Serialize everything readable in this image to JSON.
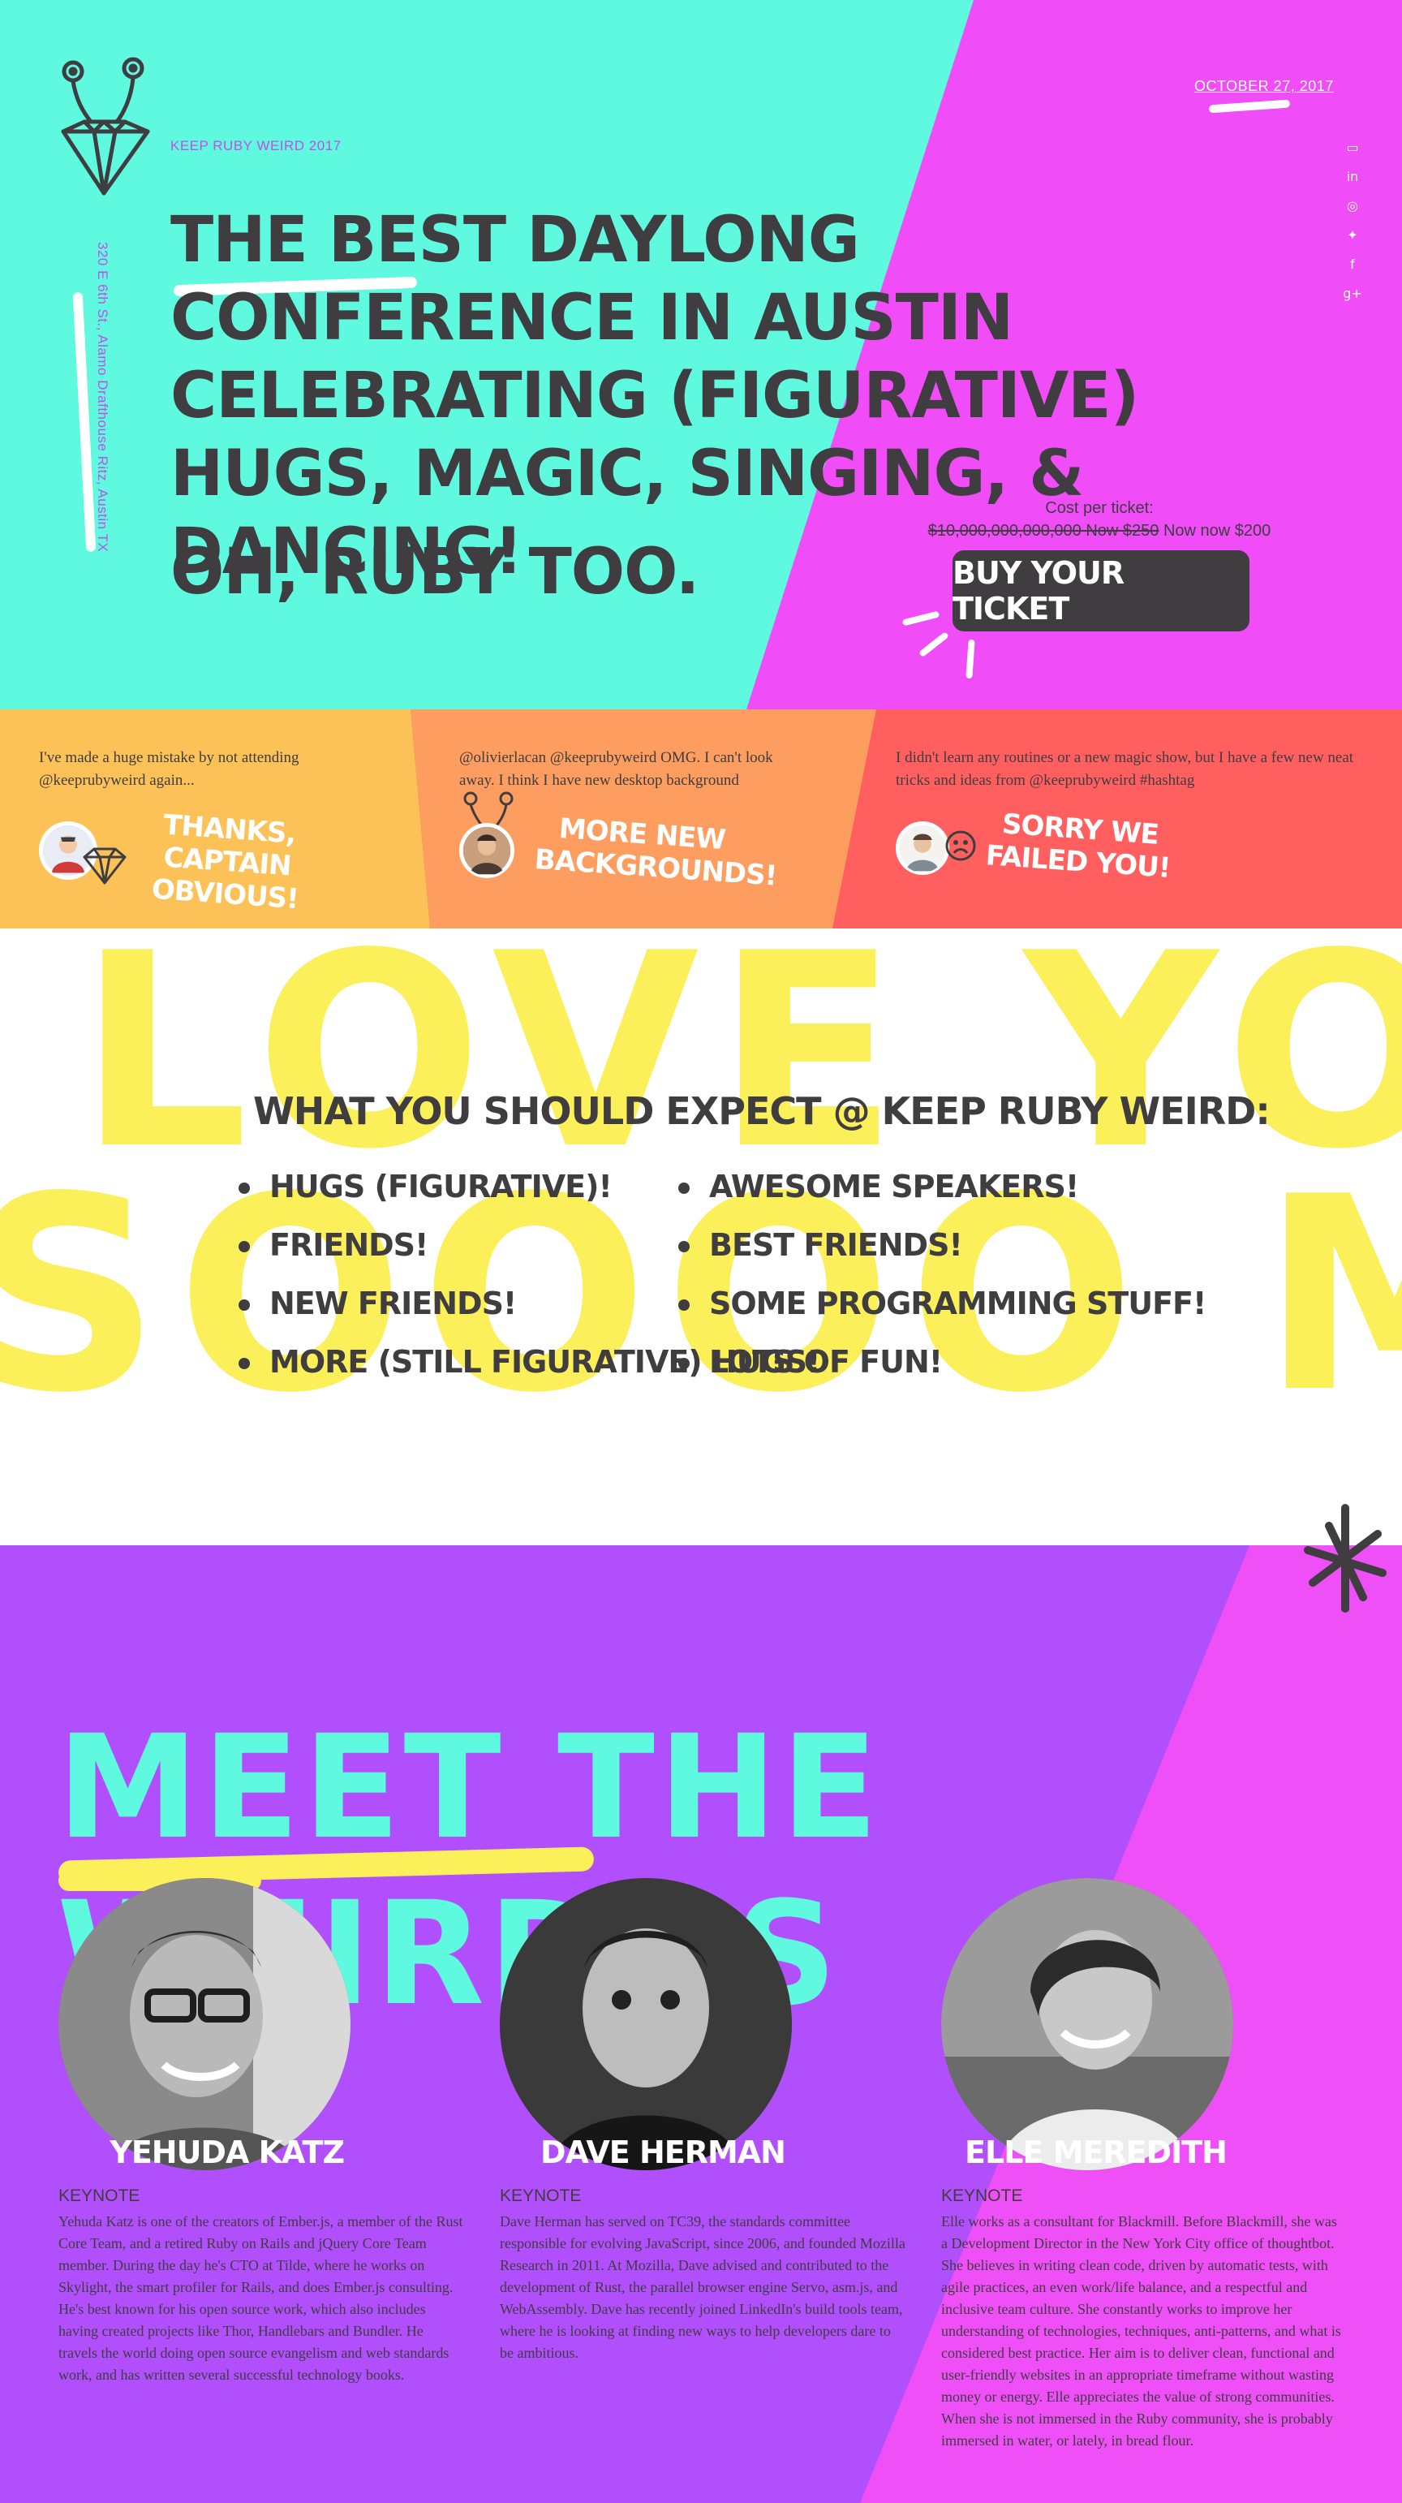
{
  "hero": {
    "brand": "KEEP RUBY WEIRD 2017",
    "address": "320 E 6th St., Alamo Drafthouse Ritz, Austin TX",
    "date": "OCTOBER 27, 2017",
    "headline": "The best daylong conference in Austin celebrating (figurative) hugs, magic, singing, & dancing!",
    "tagline": "Oh, Ruby too.",
    "cost_label": "Cost per ticket:",
    "cost_old": "$10,000,000,000,000 Now $250",
    "cost_new": "Now now $200",
    "buy_label": "Buy your ticket",
    "social_icons": [
      "calendar-icon",
      "linkedin-icon",
      "instagram-icon",
      "twitter-icon",
      "facebook-icon",
      "google-plus-icon"
    ],
    "social_glyphs": [
      "▭",
      "in",
      "◎",
      "✦",
      "f",
      "g+"
    ]
  },
  "tweets": [
    {
      "text": "I've made a huge mistake by not attending @keeprubyweird again...",
      "reply": "Thanks, Captain Obvious!"
    },
    {
      "text": "@olivierlacan @keeprubyweird OMG. I can't look away. I think I have new desktop background",
      "reply": "More new backgrounds!"
    },
    {
      "text": "I didn't learn any routines or a new magic show, but I have a few new neat tricks and ideas from @keeprubyweird #hashtag",
      "reply": "Sorry we failed you!"
    }
  ],
  "expect": {
    "title": "What you should expect @ Keep Ruby Weird:",
    "background_line1": "LOVE YOU",
    "background_line2": "SOOOO MUCH",
    "col1": [
      "Hugs (figurative)!",
      "Friends!",
      "New friends!",
      "More (still figurative) hugs!"
    ],
    "col2": [
      "Awesome speakers!",
      "Best friends!",
      "Some programming stuff!",
      "Lots of fun!"
    ]
  },
  "weirdos": {
    "title": "Meet the weirdos",
    "speakers": [
      {
        "name": "Yehuda Katz",
        "role": "Keynote",
        "bio": "Yehuda Katz is one of the creators of Ember.js, a member of the Rust Core Team, and a retired Ruby on Rails and jQuery Core Team member. During the day he's CTO at Tilde, where he works on Skylight, the smart profiler for Rails, and does Ember.js consulting. He's best known for his open source work, which also includes having created projects like Thor, Handlebars and Bundler. He travels the world doing open source evangelism and web standards work, and has written several successful technology books."
      },
      {
        "name": "Dave Herman",
        "role": "Keynote",
        "bio": "Dave Herman has served on TC39, the standards committee responsible for evolving JavaScript, since 2006, and founded Mozilla Research in 2011. At Mozilla, Dave advised and contributed to the development of Rust, the parallel browser engine Servo, asm.js, and WebAssembly. Dave has recently joined LinkedIn's build tools team, where he is looking at finding new ways to help developers dare to be ambitious."
      },
      {
        "name": "Elle Meredith",
        "role": "Keynote",
        "bio": "Elle works as a consultant for Blackmill. Before Blackmill, she was a Development Director in the New York City office of thoughtbot. She believes in writing clean code, driven by automatic tests, with agile practices, an even work/life balance, and a respectful and inclusive team culture. She constantly works to improve her understanding of technologies, techniques, anti-patterns, and what is considered best practice. Her aim is to deliver clean, functional and user-friendly websites in an appropriate timeframe without wasting money or energy. Elle appreciates the value of strong communities. When she is not immersed in the Ruby community, she is probably immersed in water, or lately, in bread flour."
      }
    ]
  },
  "colors": {
    "teal": "#5ff9df",
    "magenta": "#f04cf7",
    "purple": "#b04ffb",
    "yellow": "#fbf059",
    "orange": "#fd9d5f",
    "gold": "#fcc257",
    "coral": "#ff5f5f",
    "charcoal": "#3f3d40"
  }
}
